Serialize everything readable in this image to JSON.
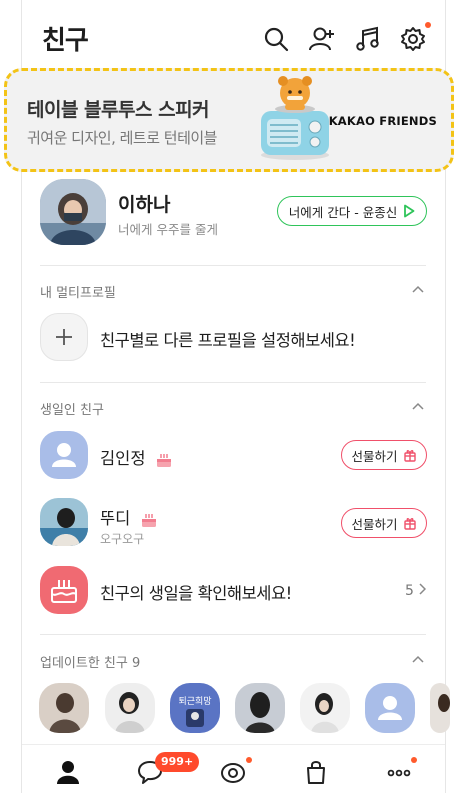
{
  "header": {
    "title": "친구"
  },
  "banner": {
    "title": "테이블 블루투스 스피커",
    "subtitle": "귀여운 디자인, 레트로 턴테이블",
    "brand": "KAKAO FRIENDS"
  },
  "profile": {
    "name": "이하나",
    "status": "너에게 우주를 줄게",
    "music": "너에게 간다 - 윤종신"
  },
  "multiprofile": {
    "section_title": "내 멀티프로필",
    "cta": "친구별로 다른 프로필을 설정해보세요!"
  },
  "birthday": {
    "section_title": "생일인 친구",
    "friends": [
      {
        "name": "김인정",
        "sub": "",
        "gift": "선물하기"
      },
      {
        "name": "뚜디",
        "sub": "오구오구",
        "gift": "선물하기"
      }
    ],
    "check_text": "친구의 생일을 확인해보세요!",
    "count": "5"
  },
  "updated": {
    "section_title": "업데이트한 친구 9",
    "third_label": "퇴근희망"
  },
  "tabbar": {
    "chat_badge": "999+"
  },
  "colors": {
    "accent_green": "#2fc45a",
    "gift_red": "#f0506a",
    "badge": "#ff4a2c",
    "banner_border": "#f3c316"
  }
}
